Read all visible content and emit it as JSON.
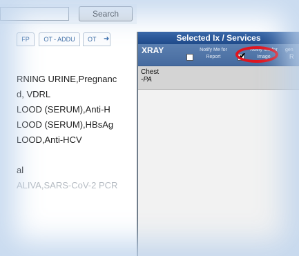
{
  "search": {
    "value": "",
    "button_label": "Search"
  },
  "tabs": [
    {
      "label": "FP"
    },
    {
      "label": "OT - ADDU"
    },
    {
      "label": "OT"
    }
  ],
  "tab_scroll_icon": "arrow-right-icon",
  "tests": [
    "RNING URINE,Pregnanc",
    "d, VDRL",
    "LOOD (SERUM),Anti-H",
    "LOOD (SERUM),HBsAg",
    "LOOD,Anti-HCV",
    "",
    "al",
    "ALIVA,SARS-CoV-2 PCR"
  ],
  "selected_panel": {
    "title": "Selected Ix / Services",
    "category": "XRAY",
    "notify_report_label": "Notify Me for Report",
    "notify_report_checked": false,
    "notify_image_label": "Notify Me for Image",
    "notify_image_checked": true,
    "extra_label": "gen",
    "extra_label_2": "R",
    "item_name": "Chest",
    "item_view": "-PA"
  },
  "colors": {
    "header_blue": "#2e5fa3",
    "annotation_red": "#e0141e",
    "tab_text": "#3d6ea6"
  }
}
